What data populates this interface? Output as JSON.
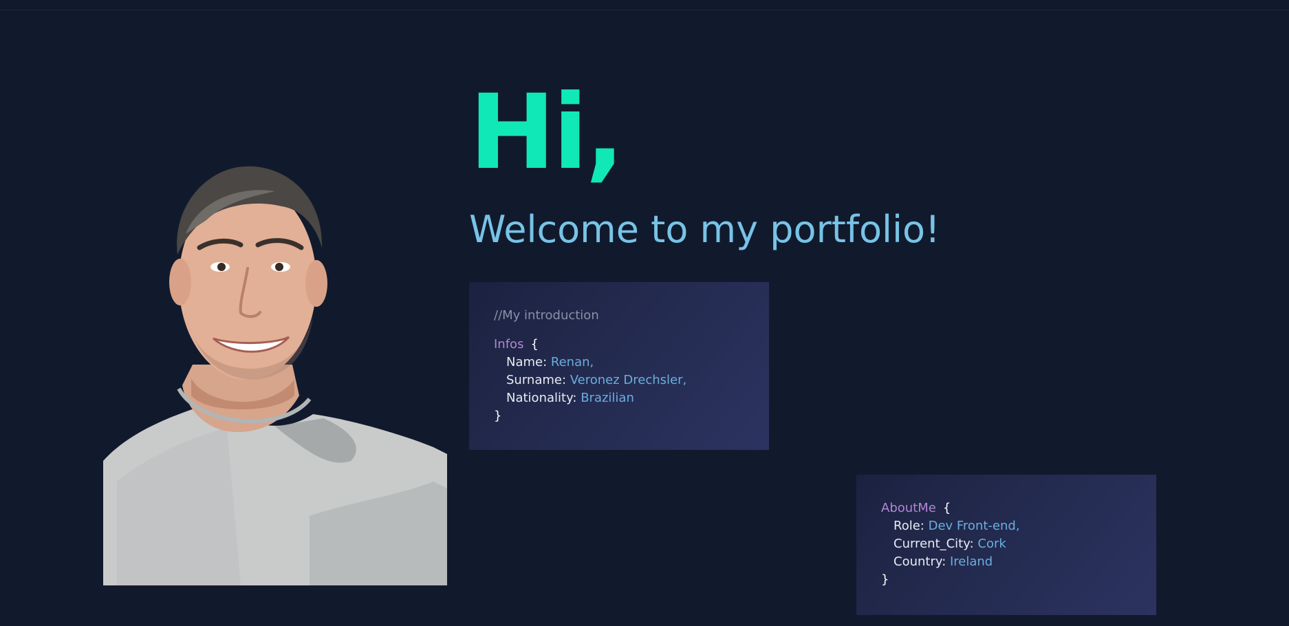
{
  "hero": {
    "greeting": "Hi,",
    "welcome": "Welcome to my portfolio!"
  },
  "intro_card": {
    "comment": "//My introduction",
    "object_name": "Infos",
    "open_brace": "{",
    "close_brace": "}",
    "fields": [
      {
        "key": "Name: ",
        "value": "Renan,"
      },
      {
        "key": "Surname: ",
        "value": "Veronez Drechsler,"
      },
      {
        "key": "Nationality: ",
        "value": "Brazilian"
      }
    ]
  },
  "about_card": {
    "object_name": "AboutMe",
    "open_brace": "{",
    "close_brace": "}",
    "fields": [
      {
        "key": "Role: ",
        "value": "Dev Front-end,"
      },
      {
        "key": "Current_City: ",
        "value": "Cork"
      },
      {
        "key": "Country: ",
        "value": "Ireland"
      }
    ]
  },
  "colors": {
    "background": "#111a2d",
    "accent_green": "#10e8b8",
    "accent_blue": "#78c3e6",
    "keyword_purple": "#b287d4",
    "value_blue": "#6aaede"
  }
}
